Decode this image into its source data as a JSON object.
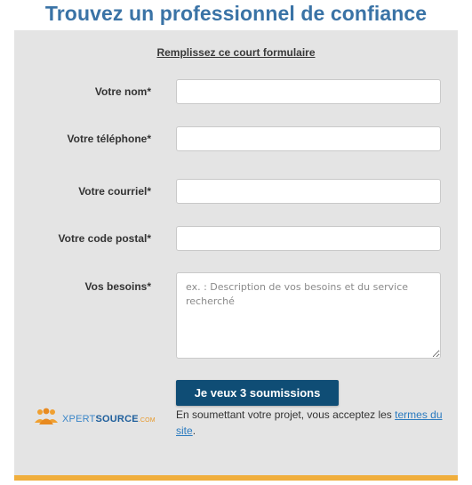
{
  "page": {
    "title": "Trouvez un professionnel de confiance"
  },
  "form": {
    "heading": "Remplissez ce court formulaire",
    "fields": {
      "name": {
        "label": "Votre nom*",
        "value": ""
      },
      "phone": {
        "label": "Votre téléphone*",
        "value": ""
      },
      "email": {
        "label": "Votre courriel*",
        "value": ""
      },
      "postal": {
        "label": "Votre code postal*",
        "value": ""
      },
      "needs": {
        "label": "Vos besoins*",
        "value": "",
        "placeholder": "ex. : Description de vos besoins et du service recherché"
      }
    },
    "submit_label": "Je veux 3 soumissions",
    "consent_text": "En soumettant votre projet, vous acceptez les ",
    "consent_link": "termes du site",
    "consent_end": "."
  },
  "brand": {
    "part1": "XPERT",
    "part2": "SOURCE",
    "part3": ".COM",
    "icon": "people-group-icon"
  },
  "colors": {
    "title": "#3a73a6",
    "card_background": "#e4e4e4",
    "accent_bar": "#f0ae3c",
    "button": "#0f4d75",
    "link": "#2a7abf"
  }
}
